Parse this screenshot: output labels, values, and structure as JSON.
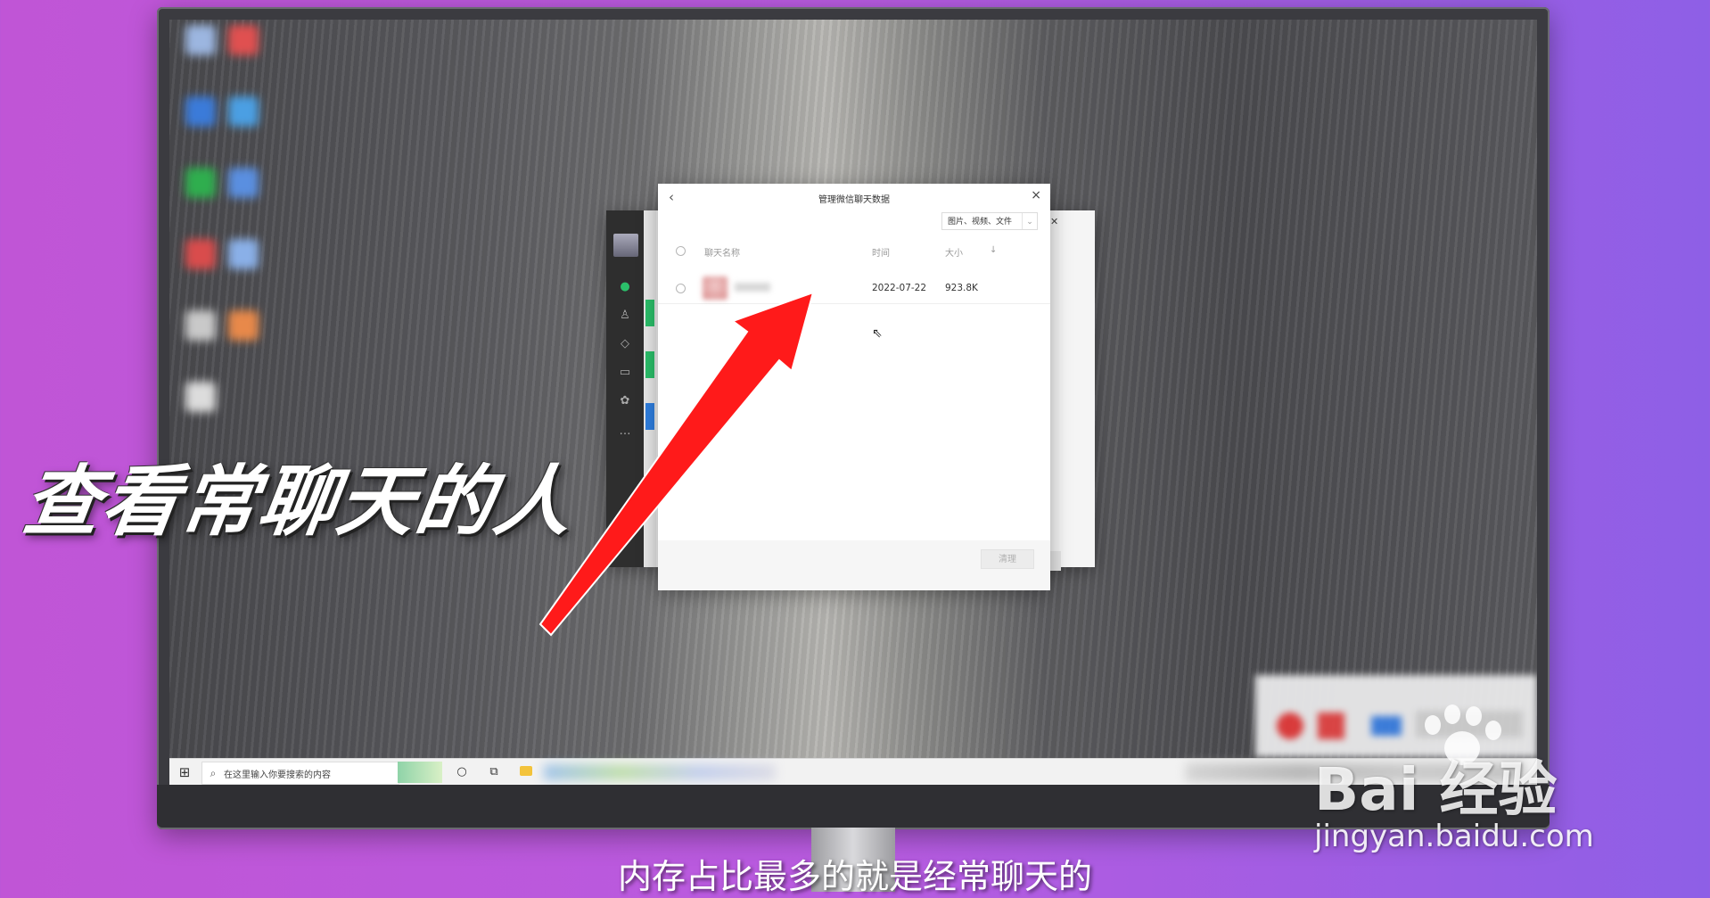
{
  "caption": {
    "headline": "查看常聊天的人",
    "subtitle": "内存占比最多的就是经常聊天的"
  },
  "watermark": {
    "brand": "Bai 经验",
    "url": "jingyan.baidu.com"
  },
  "taskbar": {
    "search_placeholder": "在这里输入你要搜索的内容"
  },
  "wechat_window": {
    "button_fragment": "(S)"
  },
  "dialog": {
    "title": "管理微信聊天数据",
    "filter_value": "图片、视频、文件",
    "columns": {
      "name": "聊天名称",
      "time": "时间",
      "size": "大小",
      "sort": "↓"
    },
    "rows": [
      {
        "time": "2022-07-22",
        "size": "923.8K"
      }
    ],
    "clean_button": "清理"
  },
  "icons": {
    "back": "chevron-left-icon",
    "close": "close-icon",
    "chevron": "chevron-down-icon",
    "windows": "windows-start-icon",
    "search": "search-icon",
    "cortana": "cortana-icon",
    "taskview": "task-view-icon",
    "folder": "folder-icon",
    "cursor": "mouse-cursor-icon"
  },
  "colors": {
    "accent_green": "#2aae67",
    "arrow_red": "#ff1a1a",
    "background_purple": "#b85be0"
  }
}
